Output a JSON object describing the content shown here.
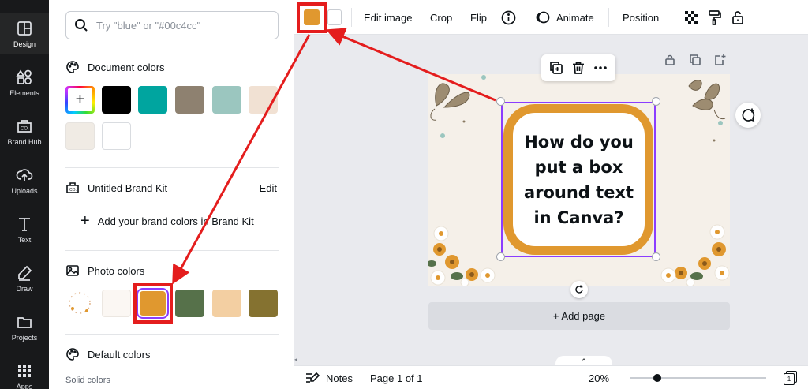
{
  "rail": {
    "items": [
      {
        "label": "Design",
        "icon": "layout-icon"
      },
      {
        "label": "Elements",
        "icon": "shapes-icon"
      },
      {
        "label": "Brand Hub",
        "icon": "brand-icon"
      },
      {
        "label": "Uploads",
        "icon": "upload-icon"
      },
      {
        "label": "Text",
        "icon": "text-icon"
      },
      {
        "label": "Draw",
        "icon": "draw-icon"
      },
      {
        "label": "Projects",
        "icon": "folder-icon"
      },
      {
        "label": "Apps",
        "icon": "apps-icon"
      }
    ]
  },
  "panel": {
    "search": {
      "placeholder": "Try \"blue\" or \"#00c4cc\"",
      "value": ""
    },
    "document_colors": {
      "title": "Document colors",
      "swatches": [
        "#000000",
        "#00a59f",
        "#8e8170",
        "#9bc6bf",
        "#f1e1d3",
        "#f0ebe4",
        "#ffffff"
      ]
    },
    "brand_kit": {
      "title": "Untitled Brand Kit",
      "edit_label": "Edit",
      "add_label": "Add your brand colors in Brand Kit"
    },
    "photo_colors": {
      "title": "Photo colors",
      "swatches": [
        "#fbf7f3",
        "#e0982f",
        "#56714a",
        "#f3cfa2",
        "#857230"
      ]
    },
    "default_colors": {
      "title": "Default colors",
      "solid_label": "Solid colors"
    }
  },
  "toolbar": {
    "fill_color": "#e0982f",
    "edit_image": "Edit image",
    "crop": "Crop",
    "flip": "Flip",
    "animate": "Animate",
    "position": "Position"
  },
  "canvas": {
    "text": "How do you put a box around text in Canva?",
    "box_color": "#e0982f",
    "add_page": "+ Add page"
  },
  "bottombar": {
    "notes": "Notes",
    "page_indicator": "Page 1 of 1",
    "zoom": "20%",
    "zoom_level": 0.2,
    "page_count": "1"
  },
  "annotation": {
    "color": "#e41d1d"
  }
}
